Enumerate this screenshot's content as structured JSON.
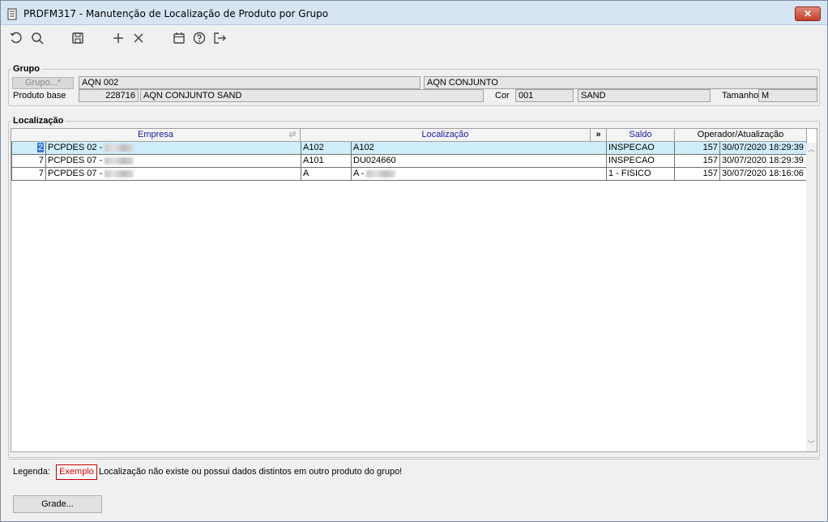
{
  "window": {
    "title": "PRDFM317 - Manutenção de Localização de Produto por Grupo",
    "close_label": "✕"
  },
  "toolbar": {
    "icons": [
      "refresh-icon",
      "search-icon",
      "save-icon",
      "add-icon",
      "delete-icon",
      "calendar-icon",
      "help-icon",
      "exit-icon"
    ]
  },
  "grupo": {
    "section_label": "Grupo",
    "button_label": "Grupo...*",
    "code": "AQN 002",
    "description": "AQN CONJUNTO",
    "produto_base_label": "Produto base",
    "produto_base_code": "228716",
    "produto_base_desc": "AQN CONJUNTO SAND",
    "cor_label": "Cor",
    "cor_code": "001",
    "cor_desc": "SAND",
    "tamanho_label": "Tamanho",
    "tamanho_value": "M"
  },
  "localizacao": {
    "section_label": "Localização",
    "headers": {
      "empresa": "Empresa",
      "localizacao": "Localização",
      "expand": "»",
      "saldo": "Saldo",
      "operador": "Operador/Atualização"
    },
    "rows": [
      {
        "num": "2",
        "empresa": "PCPDES 02 -",
        "loc_code": "A102",
        "loc_desc": "A102",
        "saldo": "INSPECAO",
        "operador": "157",
        "data": "30/07/2020 18:29:39"
      },
      {
        "num": "7",
        "empresa": "PCPDES 07 -",
        "loc_code": "A101",
        "loc_desc": "DU024660",
        "saldo": "INSPECAO",
        "operador": "157",
        "data": "30/07/2020 18:29:39"
      },
      {
        "num": "7",
        "empresa": "PCPDES 07 -",
        "loc_code": "A",
        "loc_desc": "A -",
        "saldo": "1 - FISICO",
        "operador": "157",
        "data": "30/07/2020 18:16:06"
      }
    ]
  },
  "legenda": {
    "label": "Legenda:",
    "exemplo": "Exemplo",
    "text": "Localização não existe ou possui dados distintos em outro produto do grupo!"
  },
  "footer": {
    "grade_button": "Grade..."
  }
}
